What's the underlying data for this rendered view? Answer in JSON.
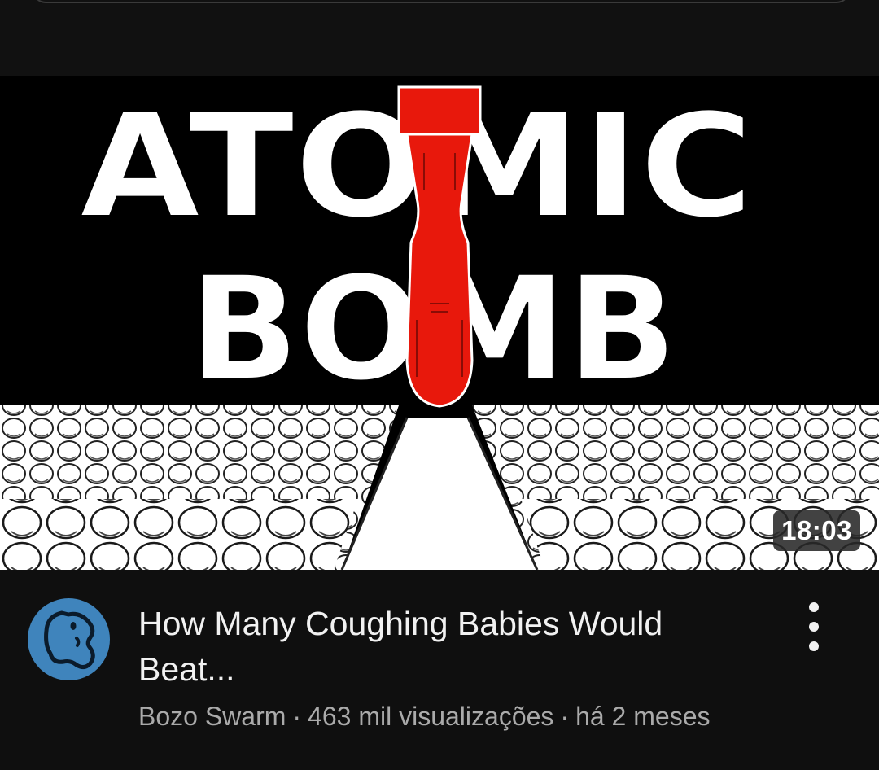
{
  "video": {
    "thumbnail_text_line1": "ATOMIC",
    "thumbnail_text_line2": "BOMB",
    "duration": "18:03",
    "title": "How Many Coughing Babies Would Beat...",
    "channel": "Bozo Swarm",
    "views": "463 mil visualizações",
    "age": "há 2 meses",
    "separator": "·"
  },
  "icons": {
    "menu": "more-vert-icon",
    "avatar": "channel-avatar-icon"
  },
  "colors": {
    "background": "#0f0f0f",
    "bomb_red": "#e8180c",
    "avatar_blue": "#3f84bc",
    "meta_gray": "#aaaaaa"
  }
}
